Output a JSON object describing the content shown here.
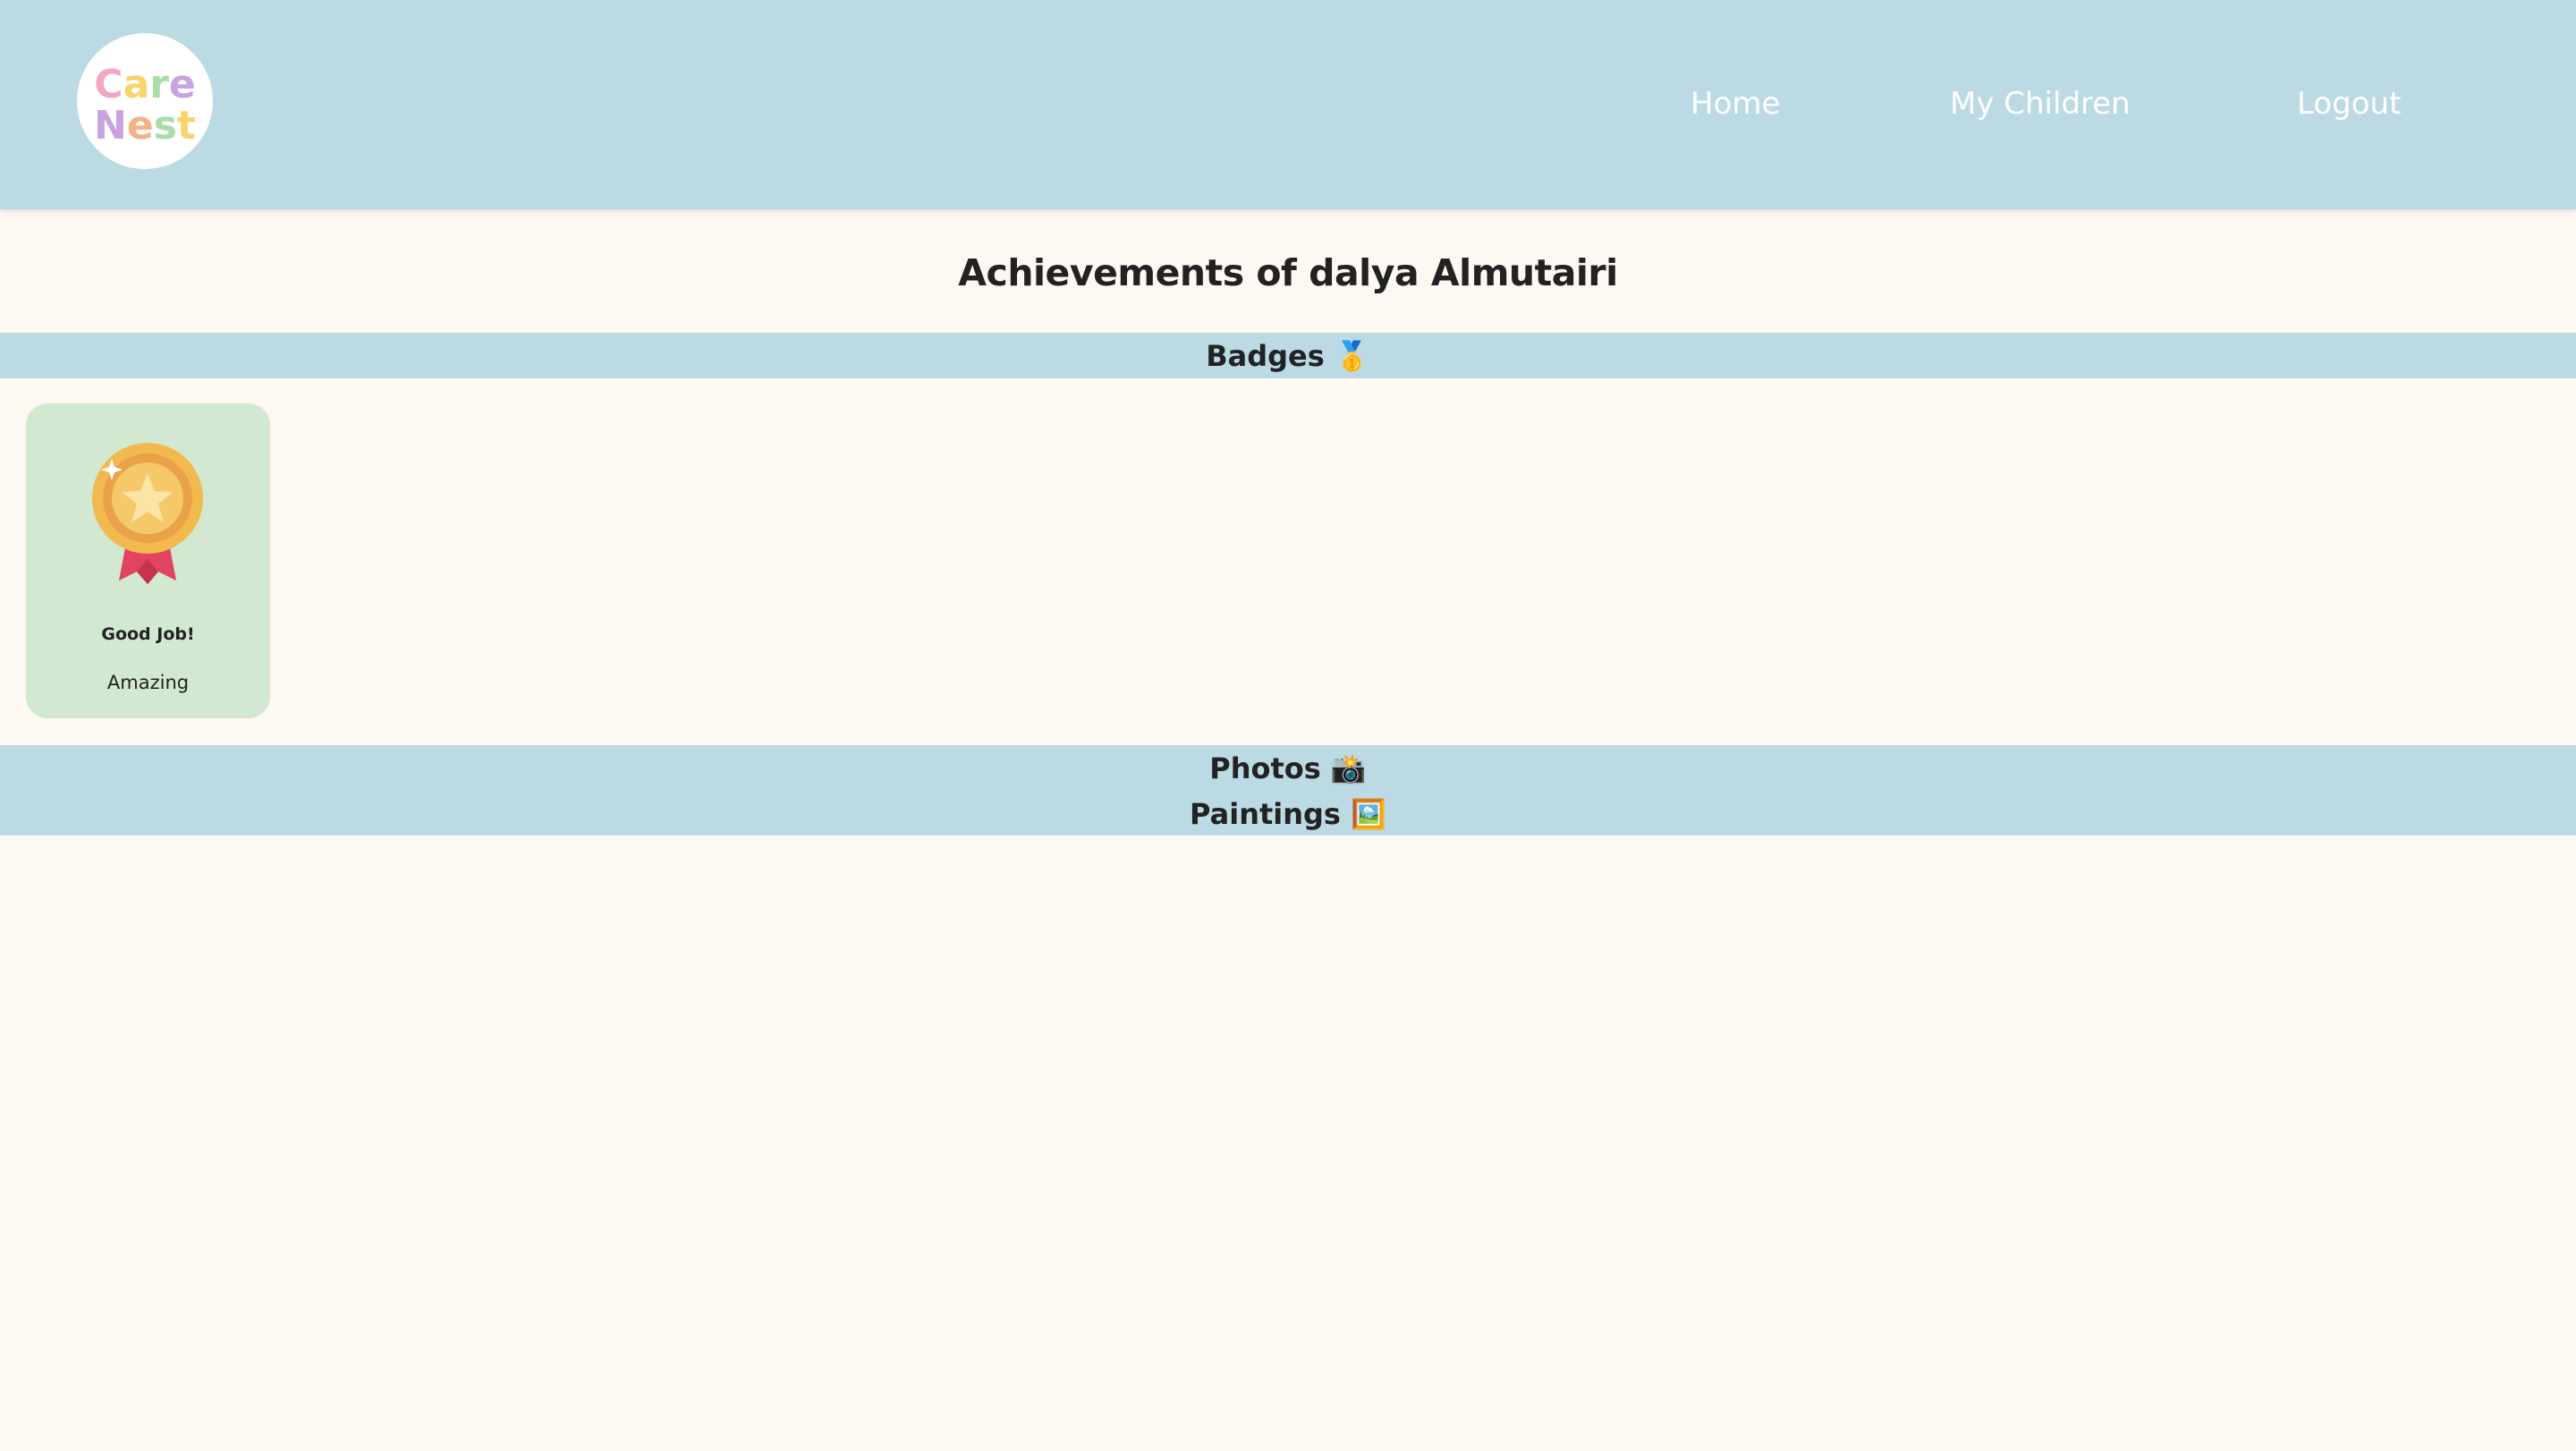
{
  "header": {
    "logo": {
      "line1": "Care",
      "line2": "Nest",
      "icon": "carenest-logo"
    },
    "nav": {
      "home": "Home",
      "my_children": "My Children",
      "logout": "Logout"
    }
  },
  "main": {
    "title": "Achievements of dalya Almutairi",
    "sections": {
      "badges": {
        "label": "Badges",
        "emoji": "🥇"
      },
      "photos": {
        "label": "Photos",
        "emoji": "📸"
      },
      "paintings": {
        "label": "Paintings",
        "emoji": "🖼️"
      }
    },
    "badges": [
      {
        "name": "Good Job!",
        "description": "Amazing",
        "icon": "medal-star-icon"
      }
    ]
  },
  "colors": {
    "header_bg": "#bbdae3",
    "page_bg": "#fdf9f2",
    "badge_card_bg": "#d3e8d1",
    "text": "#222222",
    "nav_text": "#ffffff",
    "logo_pink": "#f2a6c4",
    "logo_yellow": "#f7d46c",
    "logo_green": "#a8dca8",
    "logo_purple": "#c9a3e0",
    "logo_orange": "#f4b183"
  }
}
